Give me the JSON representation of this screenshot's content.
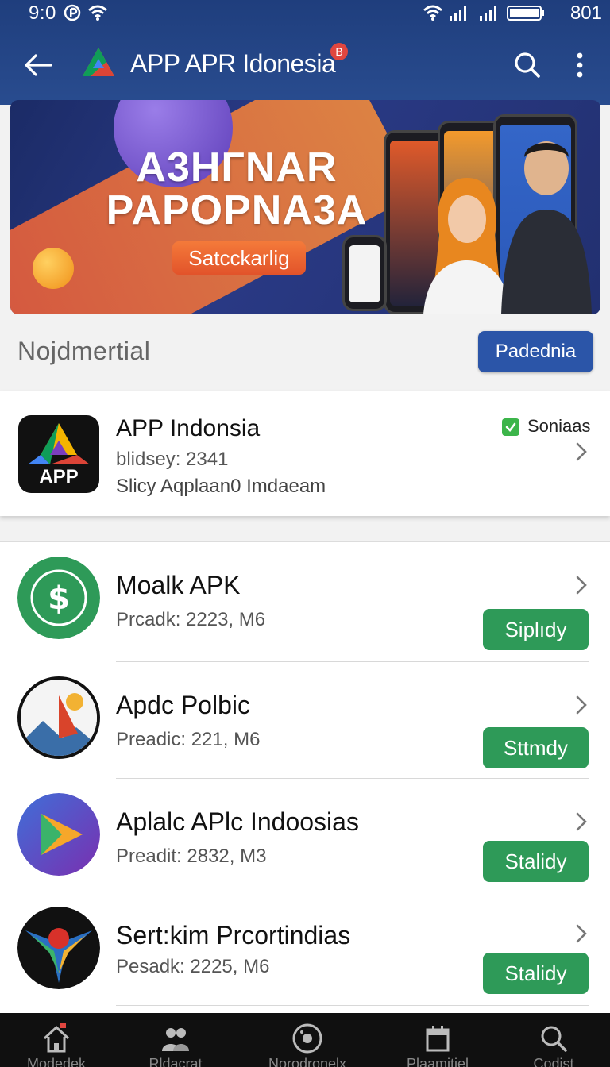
{
  "status_bar": {
    "time": "9:0",
    "battery_text": "801"
  },
  "app_bar": {
    "title": "APP APR Idonesia",
    "badge": "B",
    "icons": [
      "back-arrow-icon",
      "app-logo-icon",
      "search-icon",
      "more-vert-icon"
    ]
  },
  "banner": {
    "headline_line1": "A3HГNAR",
    "headline_line2": "PAPOPNA3A",
    "cta_label": "Satcckarlig"
  },
  "section": {
    "title": "Nojdmertial",
    "button_label": "Padednia"
  },
  "featured": {
    "name": "APP Indonsia",
    "icon_text": "APP",
    "meta_line1": "blidsey: 2341",
    "meta_line2": "Slicy Aqplaan0 Imdaeam",
    "check_label": "Soniaas"
  },
  "apps": [
    {
      "name": "Moalk APK",
      "meta": "Prcadk: 2223, M6",
      "button": "Siplıdy",
      "icon": "dollar-badge-icon"
    },
    {
      "name": "Apdc Polbic",
      "meta": "Preadic:  221, M6",
      "button": "Sttmdy",
      "icon": "mountain-sail-icon"
    },
    {
      "name": "Aplalc APlc Indoosias",
      "meta": "Preadit: 2832, M3",
      "button": "Stalidy",
      "icon": "play-arrow-icon"
    },
    {
      "name": "Sert:kim Prcortindias",
      "meta": "Pesadk: 2225, M6",
      "button": "Stalidy",
      "icon": "star-emblem-icon"
    }
  ],
  "bottom_nav": [
    {
      "label": "Modedek",
      "icon": "home-icon"
    },
    {
      "label": "Rldacrat",
      "icon": "people-icon"
    },
    {
      "label": "Norodronelx",
      "icon": "disc-icon"
    },
    {
      "label": "Plaamitiel",
      "icon": "calendar-icon"
    },
    {
      "label": "Codist",
      "icon": "search-icon"
    }
  ],
  "colors": {
    "app_bar": "#1f3e7d",
    "primary_button": "#2b55a8",
    "install_button": "#2e9a58",
    "check": "#3cb54a",
    "badge": "#e0463f"
  }
}
